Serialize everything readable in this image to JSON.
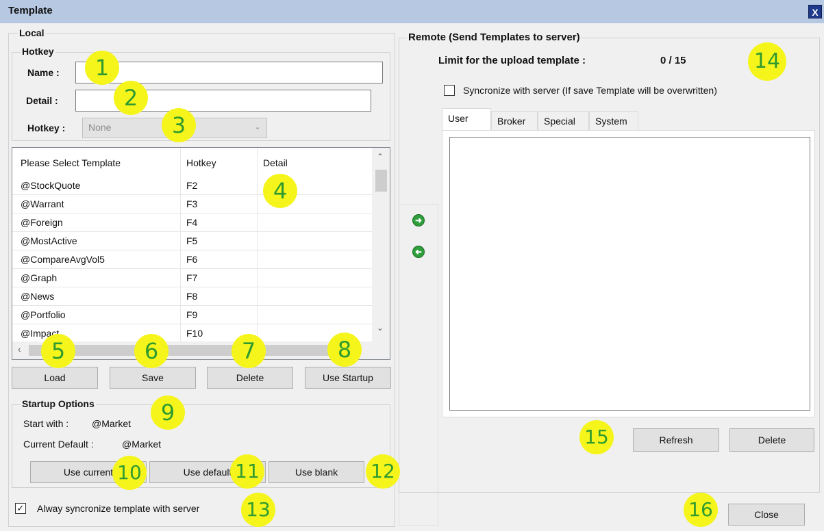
{
  "window": {
    "title": "Template",
    "close_label": "X"
  },
  "local": {
    "legend": "Local",
    "hotkey_group": {
      "legend": "Hotkey",
      "name_label": "Name :",
      "name_value": "",
      "detail_label": "Detail :",
      "detail_value": "",
      "hotkey_label": "Hotkey :",
      "hotkey_value": "None"
    },
    "list": {
      "columns": [
        "Please Select Template",
        "Hotkey",
        "Detail"
      ],
      "rows": [
        {
          "name": "@StockQuote",
          "hotkey": "F2",
          "detail": ""
        },
        {
          "name": "@Warrant",
          "hotkey": "F3",
          "detail": ""
        },
        {
          "name": "@Foreign",
          "hotkey": "F4",
          "detail": ""
        },
        {
          "name": "@MostActive",
          "hotkey": "F5",
          "detail": ""
        },
        {
          "name": "@CompareAvgVol5",
          "hotkey": "F6",
          "detail": ""
        },
        {
          "name": "@Graph",
          "hotkey": "F7",
          "detail": ""
        },
        {
          "name": "@News",
          "hotkey": "F8",
          "detail": ""
        },
        {
          "name": "@Portfolio",
          "hotkey": "F9",
          "detail": ""
        },
        {
          "name": "@Impact",
          "hotkey": "F10",
          "detail": ""
        }
      ]
    },
    "buttons": {
      "load": "Load",
      "save": "Save",
      "delete": "Delete",
      "use_startup": "Use Startup"
    },
    "startup": {
      "legend": "Startup Options",
      "start_with_label": "Start with :",
      "start_with_value": "@Market",
      "current_default_label": "Current Default :",
      "current_default_value": "@Market",
      "use_current": "Use current",
      "use_default": "Use default",
      "use_blank": "Use blank"
    },
    "always_sync": {
      "label": "Alway syncronize template with server",
      "checked": true
    }
  },
  "remote": {
    "legend": "Remote (Send Templates to server)",
    "limit_label": "Limit for the upload template :",
    "limit_value": "0 / 15",
    "sync_label": "Syncronize with server  (If save Template will be overwritten)",
    "sync_checked": false,
    "tabs": [
      "User",
      "Broker",
      "Special",
      "System"
    ],
    "active_tab": "User",
    "refresh": "Refresh",
    "delete": "Delete"
  },
  "close_button": "Close",
  "annotations": [
    "1",
    "2",
    "3",
    "4",
    "5",
    "6",
    "7",
    "8",
    "9",
    "10",
    "11",
    "12",
    "13",
    "14",
    "15",
    "16"
  ],
  "colors": {
    "title_bar": "#b7c9e2",
    "badge_fill": "#f5f51c",
    "badge_text": "#2f9b2f",
    "arrow_green": "#2e9e3a"
  }
}
